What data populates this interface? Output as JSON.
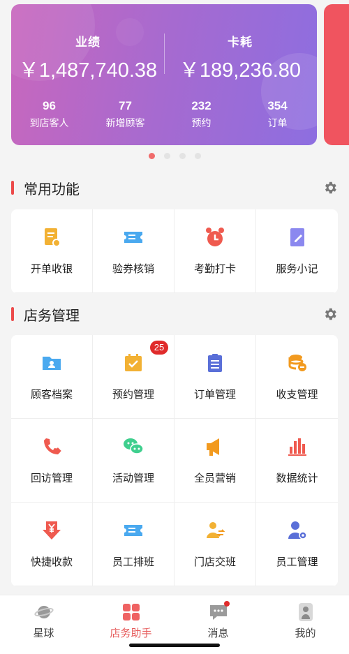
{
  "stats": {
    "performance_label": "业绩",
    "performance_value": "￥1,487,740.38",
    "consumption_label": "卡耗",
    "consumption_value": "￥189,236.80",
    "small": [
      {
        "num": "96",
        "label": "到店客人"
      },
      {
        "num": "77",
        "label": "新增顾客"
      },
      {
        "num": "232",
        "label": "预约"
      },
      {
        "num": "354",
        "label": "订单"
      }
    ],
    "card_gradient": [
      "#c867bd",
      "#8d6ee0"
    ],
    "carousel_pages": 4,
    "carousel_active_index": 0
  },
  "common": {
    "title": "常用功能",
    "items": [
      {
        "label": "开单收银",
        "icon": "cashier-receipt-icon"
      },
      {
        "label": "验券核销",
        "icon": "coupon-ticket-icon"
      },
      {
        "label": "考勤打卡",
        "icon": "alarm-clock-icon"
      },
      {
        "label": "服务小记",
        "icon": "notebook-pen-icon"
      }
    ]
  },
  "store": {
    "title": "店务管理",
    "items": [
      {
        "label": "顾客档案",
        "icon": "customer-folder-icon"
      },
      {
        "label": "预约管理",
        "icon": "calendar-check-icon",
        "badge": "25"
      },
      {
        "label": "订单管理",
        "icon": "clipboard-list-icon"
      },
      {
        "label": "收支管理",
        "icon": "coins-icon"
      },
      {
        "label": "回访管理",
        "icon": "phone-callback-icon"
      },
      {
        "label": "活动管理",
        "icon": "chat-bubbles-icon"
      },
      {
        "label": "全员营销",
        "icon": "megaphone-icon"
      },
      {
        "label": "数据统计",
        "icon": "bar-chart-icon"
      },
      {
        "label": "快捷收款",
        "icon": "yuan-download-icon"
      },
      {
        "label": "员工排班",
        "icon": "schedule-ticket-icon"
      },
      {
        "label": "门店交班",
        "icon": "staff-exchange-icon"
      },
      {
        "label": "员工管理",
        "icon": "staff-settings-icon"
      }
    ]
  },
  "tabs": [
    {
      "label": "星球",
      "icon": "planet-icon",
      "active": false
    },
    {
      "label": "店务助手",
      "icon": "grid-icon",
      "active": true
    },
    {
      "label": "消息",
      "icon": "message-icon",
      "active": false,
      "has_dot": true
    },
    {
      "label": "我的",
      "icon": "person-icon",
      "active": false
    }
  ],
  "colors": {
    "accent": "#e65a5a",
    "badge": "#e02b2b",
    "section_bar": "#ec4b4b"
  }
}
